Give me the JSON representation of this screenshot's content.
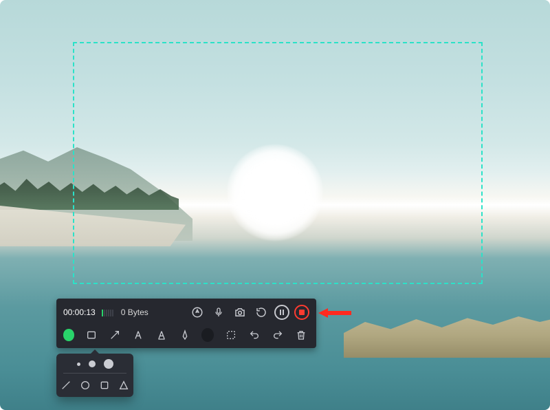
{
  "recording": {
    "timer": "00:00:13",
    "file_size": "0 Bytes",
    "audio_level_bars_on": 1,
    "audio_level_bars_total": 6
  },
  "top_controls": {
    "cursor_label": "cursor-highlight",
    "mic_label": "microphone",
    "camera_label": "screenshot",
    "restart_label": "restart",
    "pause_label": "pause",
    "stop_label": "stop"
  },
  "bottom_tools": {
    "color": "#29d36a",
    "rect_label": "rectangle",
    "arrow_label": "arrow",
    "text_label": "text",
    "highlight_label": "highlighter",
    "pen_label": "pen",
    "eraser_label": "eraser",
    "marquee_label": "marquee-select",
    "undo_label": "undo",
    "redo_label": "redo",
    "trash_label": "delete"
  },
  "popover": {
    "sizes": [
      "small",
      "medium",
      "large"
    ],
    "shapes": [
      "line",
      "circle",
      "square",
      "triangle"
    ]
  },
  "callout": {
    "arrow_color": "#ff2a1f"
  }
}
